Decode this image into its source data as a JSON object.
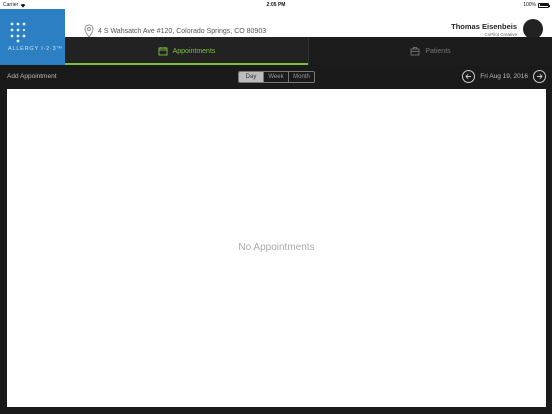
{
  "status_bar": {
    "carrier": "Carrier",
    "time": "2:05 PM",
    "battery": "100%"
  },
  "logo": {
    "brand": "ALLERGY I·2·3™"
  },
  "header": {
    "address": "4 S Wahsatch Ave #120, Colorado Springs, CO 80903",
    "user_name": "Thomas Eisenbeis",
    "user_company": "CoPilot Creative"
  },
  "tabs": [
    {
      "label": "Appointments",
      "icon": "calendar-icon",
      "active": true
    },
    {
      "label": "Patients",
      "icon": "briefcase-icon",
      "active": false
    }
  ],
  "toolbar": {
    "add_label": "Add Appointment",
    "views": [
      "Day",
      "Week",
      "Month"
    ],
    "selected_view": "Day",
    "date": "Fri Aug 19, 2016"
  },
  "main": {
    "empty_message": "No Appointments"
  },
  "colors": {
    "accent": "#7cc03e",
    "brand": "#2d7fc4"
  }
}
